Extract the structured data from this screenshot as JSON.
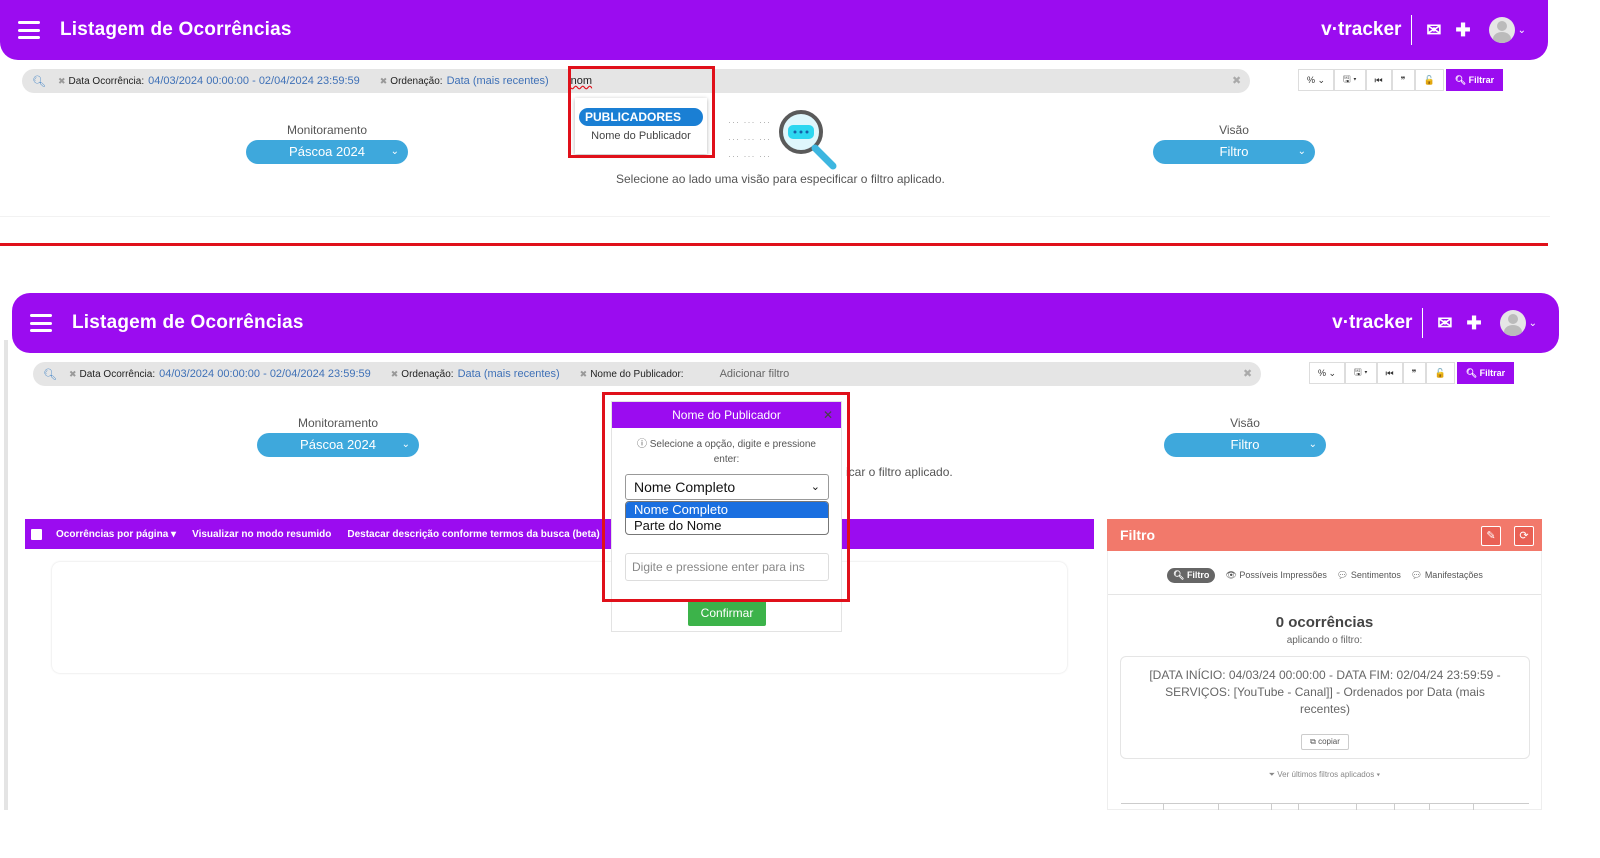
{
  "header": {
    "title": "Listagem de Ocorrências",
    "brand": "v·tracker",
    "mail_icon": "✉",
    "plus_icon": "✚",
    "avatar_caret": "⌄"
  },
  "filterbar_top": {
    "chip_date_label": "Data Ocorrência:",
    "chip_date_value": "04/03/2024 00:00:00 - 02/04/2024 23:59:59",
    "chip_order_label": "Ordenação:",
    "chip_order_value": "Data (mais recentes)",
    "search_text": "nom"
  },
  "filterbar_bottom": {
    "chip_date_label": "Data Ocorrência:",
    "chip_date_value": "04/03/2024 00:00:00 - 02/04/2024 23:59:59",
    "chip_order_label": "Ordenação:",
    "chip_order_value": "Data (mais recentes)",
    "chip_pub_label": "Nome do Publicador:",
    "add_filter_placeholder": "Adicionar filtro"
  },
  "toolbar": {
    "percent": "% ⌄",
    "save": "🖫 ▾",
    "first": "⏮",
    "quote": "❞",
    "unlock": "🔓",
    "filter_label": "Filtrar"
  },
  "selectors": {
    "monitor_label": "Monitoramento",
    "monitor_value": "Páscoa 2024",
    "view_label": "Visão",
    "view_value": "Filtro"
  },
  "hint_top": "Selecione ao lado uma visão para especificar o filtro aplicado.",
  "hint_bottom_partial": "icar o filtro aplicado.",
  "autocomplete": {
    "group": "PUBLICADORES",
    "item": "Nome do Publicador"
  },
  "modal": {
    "title": "Nome do Publicador",
    "help": "Selecione a opção, digite e pressione enter:",
    "select_value": "Nome Completo",
    "options": [
      "Nome Completo",
      "Parte do Nome"
    ],
    "input_placeholder": "Digite e pressione enter para ins",
    "confirm": "Confirmar"
  },
  "listbar": {
    "per_page": "Ocorrências por página",
    "summary": "Visualizar no modo resumido",
    "highlight": "Destacar descrição conforme termos da busca (beta)"
  },
  "panel": {
    "title": "Filtro",
    "tabs": [
      "Filtro",
      "Possíveis Impressões",
      "Sentimentos",
      "Manifestações"
    ],
    "count": "0 ocorrências",
    "applying": "aplicando o filtro:",
    "description": "[DATA INÍCIO: 04/03/24 00:00:00 - DATA FIM: 02/04/24 23:59:59 - SERVIÇOS: [YouTube - Canal]] - Ordenados por Data (mais recentes)",
    "copy": "copiar",
    "last_filters": "Ver últimos filtros aplicados"
  },
  "colors": {
    "purple": "#9b0cf0",
    "pill_blue": "#3ea8dc",
    "red_annotation": "#e0101a",
    "panel_salmon": "#f2796b",
    "confirm_green": "#3cb34a"
  }
}
